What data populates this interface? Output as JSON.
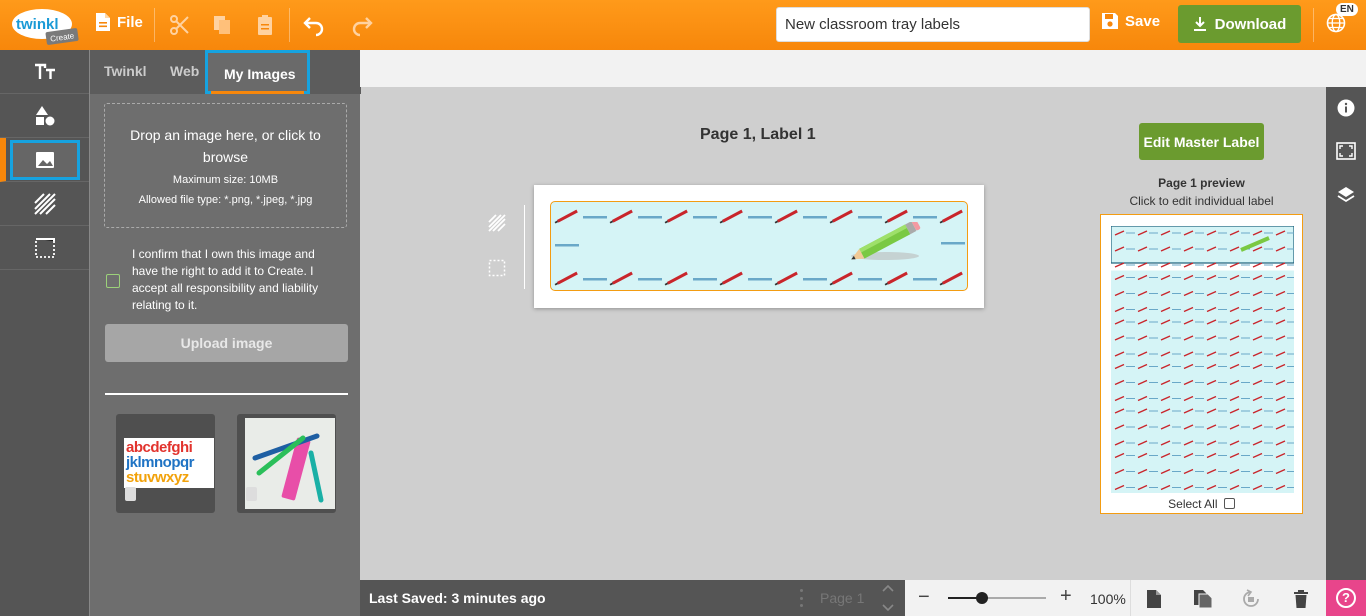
{
  "header": {
    "logo_text": "twinkl",
    "logo_sub": "Create",
    "file_label": "File",
    "document_title": "New classroom tray labels",
    "save_label": "Save",
    "download_label": "Download",
    "language": "EN"
  },
  "panel": {
    "tabs": [
      "Twinkl",
      "Web",
      "My Images"
    ],
    "active_tab": "My Images",
    "dropzone": {
      "line1": "Drop an image here, or click to",
      "line2": "browse",
      "max_size": "Maximum size: 10MB",
      "allowed": "Allowed file type: *.png, *.jpeg, *.jpg"
    },
    "confirm_text": "I confirm that I own this image and have the right to add it to Create. I accept all responsibility and liability relating to it.",
    "upload_label": "Upload image",
    "thumbnails": [
      {
        "name": "alphabet-letters",
        "lines": [
          "abcdefghi",
          "jklmnopqr",
          "stuvwxyz"
        ]
      },
      {
        "name": "pens-and-ruler"
      }
    ]
  },
  "canvas": {
    "page_label": "Page 1, Label 1"
  },
  "preview": {
    "edit_master_label": "Edit Master Label",
    "title": "Page 1 preview",
    "subtitle": "Click to edit individual label",
    "select_all": "Select All"
  },
  "footer": {
    "last_saved": "Last Saved: 3 minutes ago",
    "page_select": "Page 1",
    "zoom_minus": "−",
    "zoom_plus": "+",
    "zoom_percent": "100%",
    "zoom_level": 0.35,
    "help": "?"
  },
  "colors": {
    "brand_orange": "#f7870b",
    "accent_green": "#6b9b2f",
    "selection_blue": "#16a3e0",
    "help_pink": "#e8458b"
  }
}
